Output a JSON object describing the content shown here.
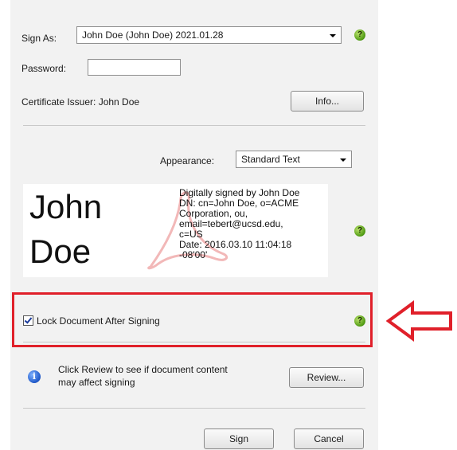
{
  "sign_as": {
    "label": "Sign As:",
    "value": "John Doe (John Doe) 2021.01.28"
  },
  "password": {
    "label": "Password:",
    "value": ""
  },
  "certificate_issuer": "Certificate Issuer: John Doe",
  "buttons": {
    "info": "Info...",
    "review": "Review...",
    "sign": "Sign",
    "cancel": "Cancel"
  },
  "appearance": {
    "label": "Appearance:",
    "value": "Standard Text"
  },
  "signature_preview": {
    "name_line1": "John",
    "name_line2": "Doe",
    "details": [
      "Digitally signed by John Doe",
      "DN: cn=John Doe, o=ACME",
      "Corporation, ou,",
      "email=tebert@ucsd.edu,",
      "c=US",
      "Date: 2016.03.10 11:04:18",
      "-08'00'"
    ]
  },
  "lock_document": {
    "label": "Lock Document After Signing",
    "checked": true
  },
  "review_info": {
    "line1": "Click Review to see if document content",
    "line2": "may affect signing"
  },
  "colors": {
    "highlight": "#e0202a",
    "help_icon": "#4f9a12",
    "info_icon": "#1f58c8"
  },
  "icons": [
    "help-icon",
    "info-icon",
    "dropdown-arrow-icon",
    "checkbox-checked-icon",
    "red-arrow-icon"
  ]
}
